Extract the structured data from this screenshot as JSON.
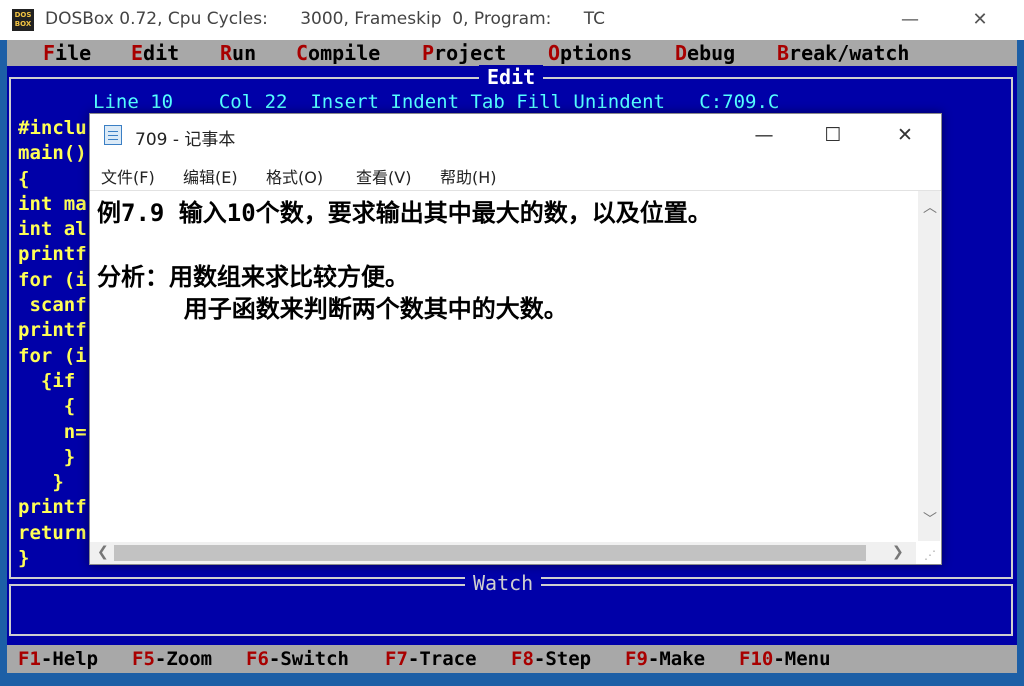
{
  "dosbox": {
    "logo": "DOS\nBOX",
    "title": "DOSBox 0.72, Cpu Cycles:      3000, Frameskip  0, Program:      TC",
    "minimize": "—",
    "maximize": "☐",
    "close": "✕"
  },
  "menubar": [
    {
      "hot": "F",
      "rest": "ile"
    },
    {
      "hot": "E",
      "rest": "dit"
    },
    {
      "hot": "R",
      "rest": "un"
    },
    {
      "hot": "C",
      "rest": "ompile"
    },
    {
      "hot": "P",
      "rest": "roject"
    },
    {
      "hot": "O",
      "rest": "ptions"
    },
    {
      "hot": "D",
      "rest": "ebug"
    },
    {
      "hot": "B",
      "rest": "reak/watch"
    }
  ],
  "editor": {
    "title": "Edit",
    "status": "Line 10    Col 22  Insert Indent Tab Fill Unindent   C:709.C",
    "code_lines": [
      "#inclu",
      "main()",
      "{",
      "int ma",
      "int al",
      "printf",
      "for (i",
      " scanf",
      "printf",
      "for (i",
      "  {if",
      "    {",
      "    n=",
      "    }",
      "   }",
      "printf",
      "return",
      "}"
    ]
  },
  "watch": {
    "title": "Watch"
  },
  "fkeys": [
    {
      "key": "F1",
      "label": "-Help"
    },
    {
      "key": "F5",
      "label": "-Zoom"
    },
    {
      "key": "F6",
      "label": "-Switch"
    },
    {
      "key": "F7",
      "label": "-Trace"
    },
    {
      "key": "F8",
      "label": "-Step"
    },
    {
      "key": "F9",
      "label": "-Make"
    },
    {
      "key": "F10",
      "label": "-Menu"
    }
  ],
  "notepad": {
    "title": "709 - 记事本",
    "minimize": "—",
    "maximize": "☐",
    "close": "✕",
    "menu": [
      "文件(F)",
      "编辑(E)",
      "格式(O)",
      "查看(V)",
      "帮助(H)"
    ],
    "lines": [
      "例7.9 输入10个数，要求输出其中最大的数，以及位置。",
      "",
      "分析：用数组来求比较方便。",
      "      用子函数来判断两个数其中的大数。"
    ]
  }
}
